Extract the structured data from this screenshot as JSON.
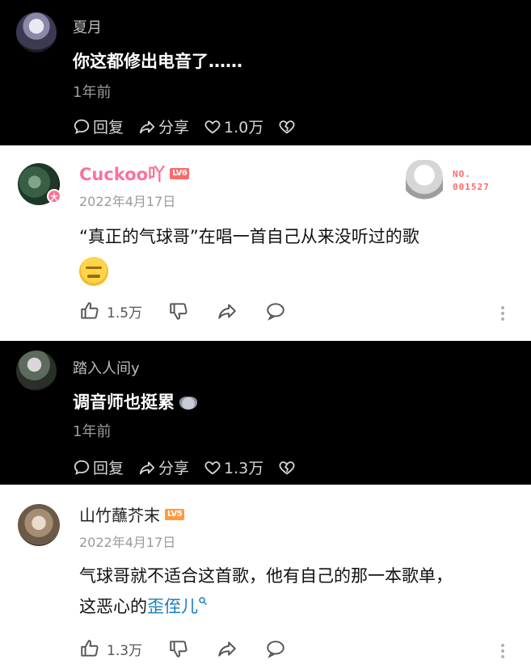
{
  "comments": [
    {
      "theme": "dark",
      "username": "夏月",
      "text": "你这都修出电音了……",
      "time": "1年前",
      "reply_label": "回复",
      "share_label": "分享",
      "likes": "1.0万"
    },
    {
      "theme": "light",
      "username": "Cuckoo吖",
      "level": "LV6",
      "avatar_badge": "大",
      "date": "2022年4月17日",
      "text": "“真正的气球哥”在唱一首自己从来没听过的歌",
      "likes": "1.5万",
      "fan_badge_label": "NO.",
      "fan_badge_number": "001527"
    },
    {
      "theme": "dark",
      "username": "踏入人间y",
      "text": "调音师也挺累",
      "time": "1年前",
      "reply_label": "回复",
      "share_label": "分享",
      "likes": "1.3万"
    },
    {
      "theme": "light",
      "username": "山竹蘸芥末",
      "level": "LV5",
      "date": "2022年4月17日",
      "text_line1": "气球哥就不适合这首歌，他有自己的那一本歌单，",
      "text_line2_prefix": "这恶心的",
      "text_link": "歪侄儿",
      "likes": "1.3万"
    }
  ],
  "colors": {
    "vip_pink": "#fb7299",
    "link_blue": "#1a7dbf",
    "level6": "#ff6a6a",
    "level5": "#ff9a3d"
  }
}
